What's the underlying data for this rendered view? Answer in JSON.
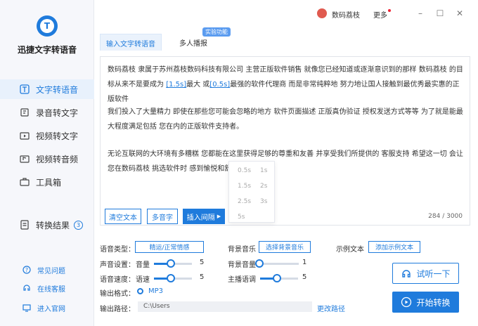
{
  "app": {
    "title": "迅捷文字转语音",
    "logo_letter": "T"
  },
  "nav": [
    {
      "label": "文字转语音",
      "icon": "text-icon",
      "active": true
    },
    {
      "label": "录音转文字",
      "icon": "recording-icon"
    },
    {
      "label": "视频转文字",
      "icon": "video-icon"
    },
    {
      "label": "视频转音频",
      "icon": "video-audio-icon"
    },
    {
      "label": "工具箱",
      "icon": "toolbox-icon"
    },
    {
      "label": "转换结果",
      "icon": "result-icon",
      "badge": "3"
    }
  ],
  "footer": [
    {
      "label": "常见问题",
      "icon": "help-icon"
    },
    {
      "label": "在线客服",
      "icon": "service-icon"
    },
    {
      "label": "进入官网",
      "icon": "website-icon"
    }
  ],
  "topbar": {
    "user": "数码荔枝",
    "more": "更多"
  },
  "tabs": {
    "tab1": "输入文字转语音",
    "tab2": "多人播报",
    "tag": "实验功能"
  },
  "editor": {
    "p1_a": "数码荔枝  隶属于苏州荔枝数码科技有限公司  主营正版软件销售  就像您已经知道或逐渐意识到的那样  数码荔枝  的目标从来不是要成为 ",
    "p1_h1": "[1.5s]",
    "p1_b": "最大 或",
    "p1_h2": "[0.5s]",
    "p1_c": "最强的软件代理商  而是非常纯粹地  努力地让国人接触到最优秀最实惠的正版软件",
    "p2": "我们投入了大量精力 即使在那些您可能会忽略的地方  软件页面描述  正版真伪验证  授权发送方式等等  为了就是能最大程度满足包括 您在内的正版软件支持者。",
    "p3": "无论互联网的大环境有多糟糕  您都能在这里获得足够的尊重和友善  并享受我们所提供的 客服支持 希望这一切 会让您在数码荔枝 挑选软件时  感到愉悦和舒心。",
    "count": "284 / 3000"
  },
  "pause_options": [
    "0.5s",
    "1s",
    "1.5s",
    "2s",
    "2.5s",
    "3s",
    "5s"
  ],
  "buttons": {
    "clear": "清空文本",
    "polyphone": "多音字",
    "insert_pause": "插入间隔"
  },
  "settings": {
    "voice_type_label": "语音类型：",
    "voice_type_btn": "精运/正常情感",
    "bgm_label": "背景音乐",
    "bgm_btn": "选择背景音乐",
    "sample_label": "示例文本",
    "sample_btn": "添加示例文本",
    "sound_label": "声音设置：",
    "volume_label": "音量",
    "volume_value": "5",
    "bg_volume_label": "背景音量",
    "bg_volume_value": "1",
    "speed_label": "语音速度：",
    "rate_label": "语速",
    "rate_value": "5",
    "pitch_label": "主播语调",
    "pitch_value": "5",
    "format_label": "输出格式：",
    "format_value": "MP3",
    "path_label": "输出路径：",
    "path_value": "C:\\Users",
    "change_path": "更改路径"
  },
  "actions": {
    "listen": "试听一下",
    "start": "开始转换"
  },
  "colors": {
    "accent": "#1f7bdc"
  }
}
